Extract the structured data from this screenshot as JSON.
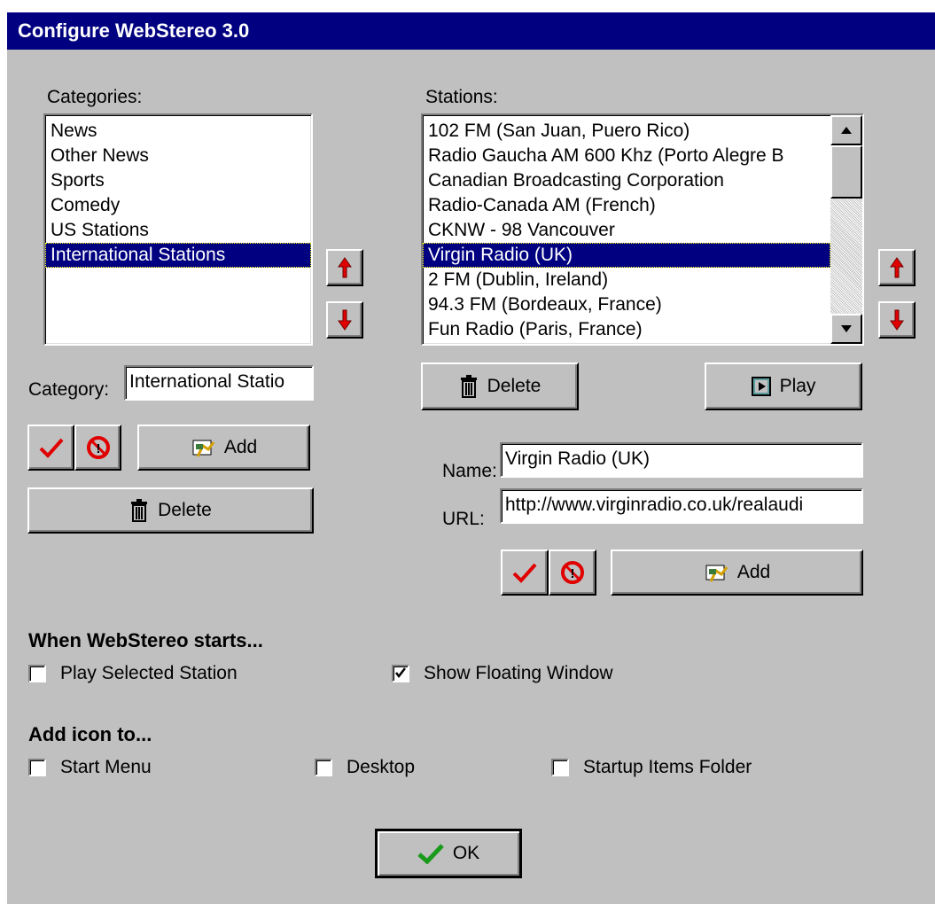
{
  "window": {
    "title": "Configure WebStereo 3.0"
  },
  "categories": {
    "label": "Categories:",
    "items": [
      "News",
      "Other News",
      "Sports",
      "Comedy",
      "US Stations",
      "International Stations"
    ],
    "selected_index": 5,
    "field_label": "Category:",
    "field_value": "International Statio",
    "add_label": "Add",
    "delete_label": "Delete"
  },
  "stations": {
    "label": "Stations:",
    "items": [
      "102 FM (San Juan, Puero Rico)",
      "Radio Gaucha AM 600 Khz (Porto Alegre B",
      "Canadian Broadcasting Corporation",
      "Radio-Canada AM (French)",
      "CKNW - 98 Vancouver",
      "Virgin Radio (UK)",
      "2 FM (Dublin, Ireland)",
      "94.3 FM (Bordeaux, France)",
      "Fun Radio (Paris, France)"
    ],
    "selected_index": 5,
    "delete_label": "Delete",
    "play_label": "Play",
    "name_label": "Name:",
    "name_value": "Virgin Radio (UK)",
    "url_label": "URL:",
    "url_value": "http://www.virginradio.co.uk/realaudi",
    "add_label": "Add"
  },
  "startup": {
    "heading": "When WebStereo starts...",
    "play_selected": {
      "label": "Play Selected Station",
      "checked": false
    },
    "show_floating": {
      "label": "Show Floating Window",
      "checked": true
    }
  },
  "icons": {
    "heading": "Add icon to...",
    "start_menu": {
      "label": "Start Menu",
      "checked": false
    },
    "desktop": {
      "label": "Desktop",
      "checked": false
    },
    "startup_folder": {
      "label": "Startup Items Folder",
      "checked": false
    }
  },
  "ok_label": "OK",
  "colors": {
    "title_bar": "#000080",
    "selection": "#000080",
    "arrow_red": "#e00000",
    "check_red": "#e00000",
    "ok_check_green": "#1a9a1a"
  }
}
